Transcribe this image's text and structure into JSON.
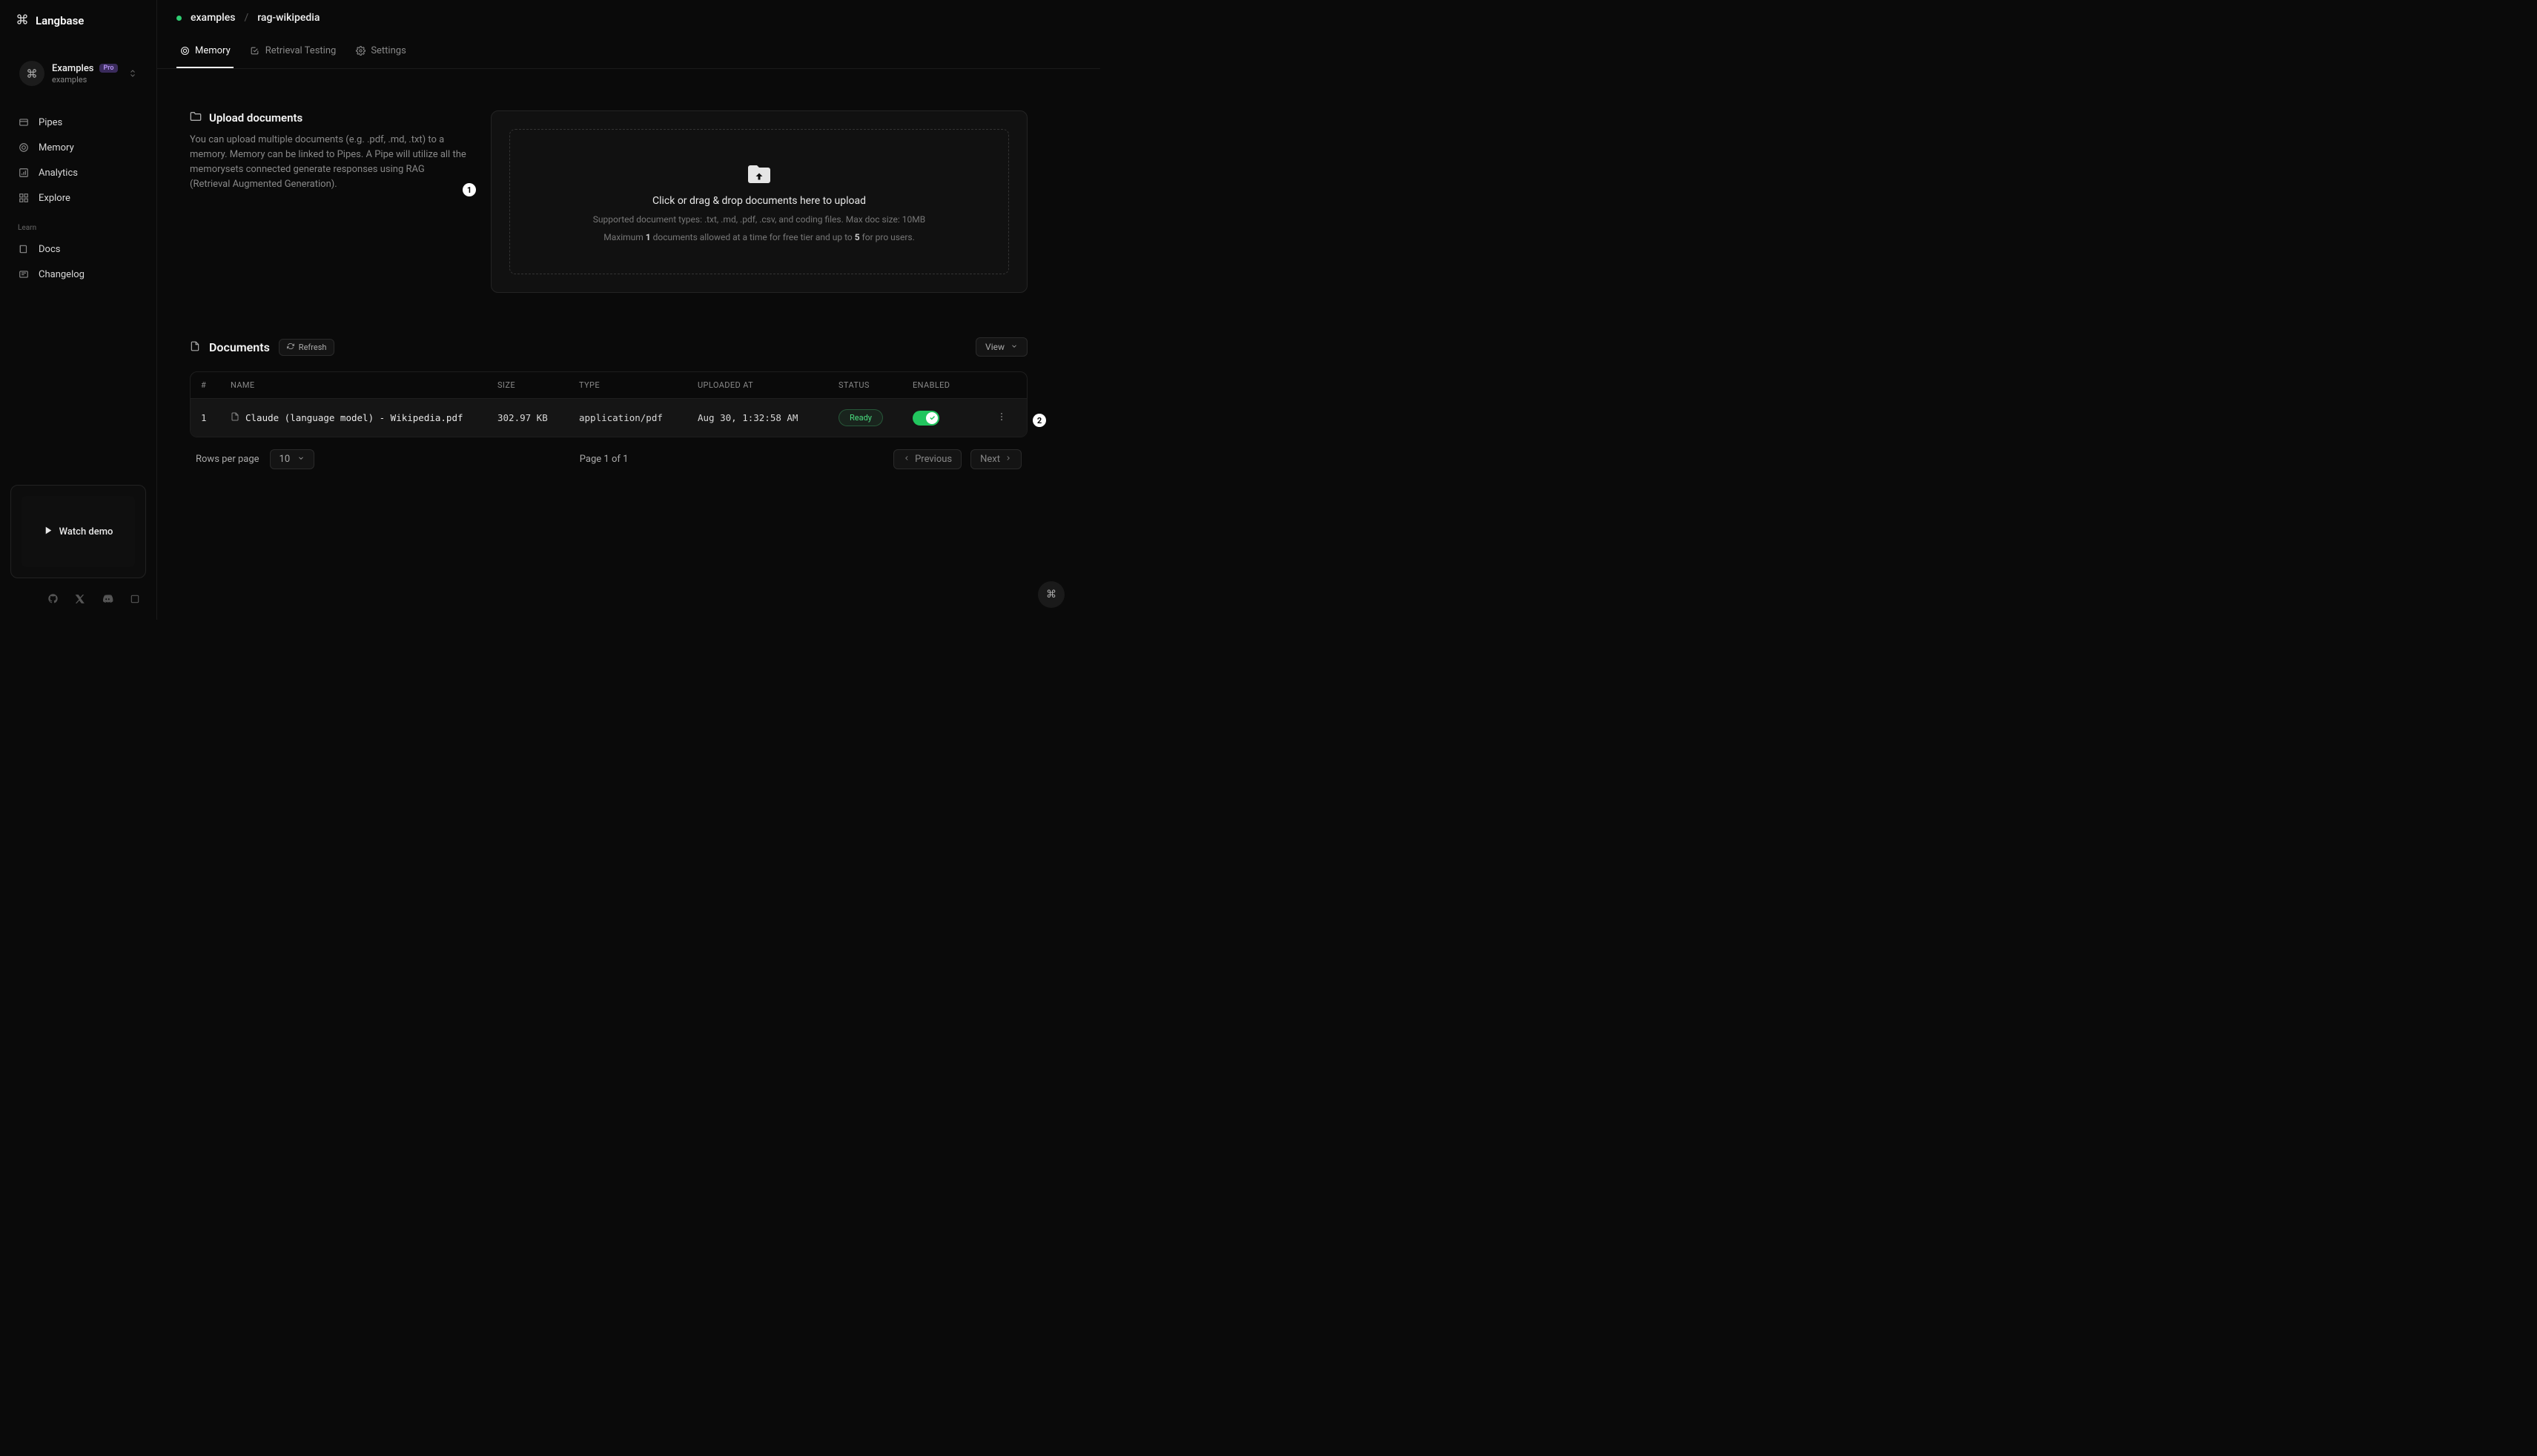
{
  "brand": "Langbase",
  "workspace": {
    "name": "Examples",
    "slug": "examples",
    "badge": "Pro"
  },
  "sidebar": {
    "items": [
      {
        "label": "Pipes"
      },
      {
        "label": "Memory"
      },
      {
        "label": "Analytics"
      },
      {
        "label": "Explore"
      }
    ],
    "learn_heading": "Learn",
    "learn": [
      {
        "label": "Docs"
      },
      {
        "label": "Changelog"
      }
    ],
    "demo_label": "Watch demo"
  },
  "breadcrumb": {
    "a": "examples",
    "sep": "/",
    "b": "rag-wikipedia"
  },
  "tabs": [
    {
      "label": "Memory"
    },
    {
      "label": "Retrieval Testing"
    },
    {
      "label": "Settings"
    }
  ],
  "upload": {
    "title": "Upload documents",
    "desc": "You can upload multiple documents (e.g. .pdf, .md, .txt) to a memory. Memory can be linked to Pipes. A Pipe will utilize all the memorysets connected generate responses using RAG (Retrieval Augmented Generation).",
    "drop_title": "Click or drag & drop documents here to upload",
    "drop_sub1": "Supported document types: .txt, .md, .pdf, .csv, and coding files. Max doc size: 10MB",
    "drop_sub2_a": "Maximum ",
    "drop_sub2_b": "1",
    "drop_sub2_c": " documents allowed at a time for free tier and up to ",
    "drop_sub2_d": "5",
    "drop_sub2_e": " for pro users."
  },
  "docs": {
    "title": "Documents",
    "refresh": "Refresh",
    "view": "View",
    "cols": {
      "num": "#",
      "name": "NAME",
      "size": "SIZE",
      "type": "TYPE",
      "uploaded": "UPLOADED AT",
      "status": "STATUS",
      "enabled": "ENABLED"
    },
    "rows": [
      {
        "num": "1",
        "name": "Claude (language model) - Wikipedia.pdf",
        "size": "302.97 KB",
        "type": "application/pdf",
        "uploaded": "Aug 30, 1:32:58 AM",
        "status": "Ready"
      }
    ],
    "pager": {
      "rows_label": "Rows per page",
      "rows_value": "10",
      "page": "Page 1 of 1",
      "prev": "Previous",
      "next": "Next"
    }
  },
  "annotations": {
    "a1": "1",
    "a2": "2"
  }
}
